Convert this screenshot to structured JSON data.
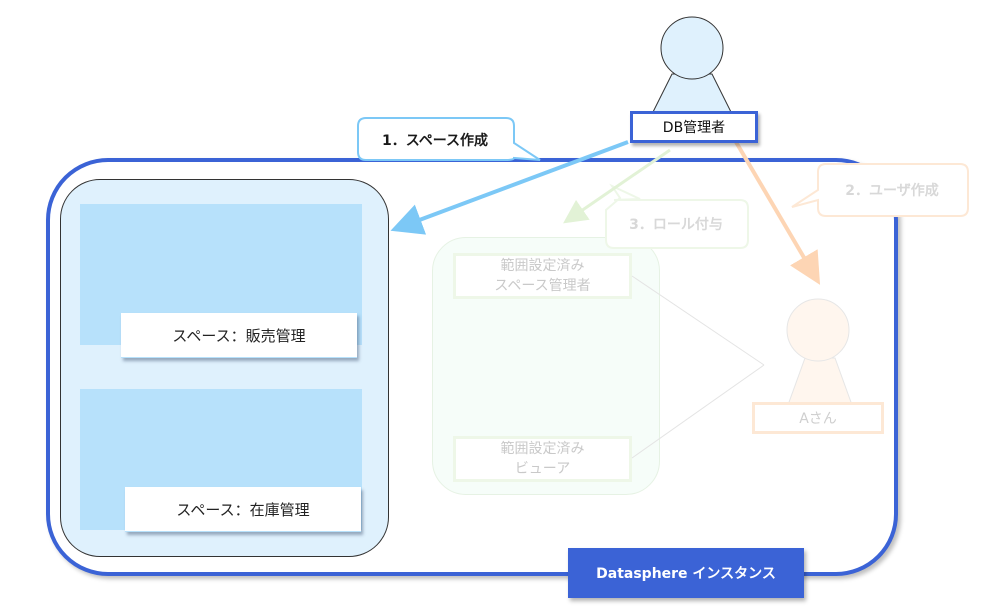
{
  "diagram": {
    "instance": {
      "label": "Datasphere インスタンス"
    },
    "spaces": [
      {
        "label": "スペース：販売管理"
      },
      {
        "label": "スペース：在庫管理"
      }
    ],
    "roles": [
      {
        "line1": "範囲設定済み",
        "line2": "スペース管理者"
      },
      {
        "line1": "範囲設定済み",
        "line2": "ビューア"
      }
    ],
    "actors": {
      "admin": {
        "label": "DB管理者"
      },
      "user": {
        "label": "Aさん"
      }
    },
    "steps": [
      {
        "label": "1．スペース作成",
        "state": "active"
      },
      {
        "label": "2．ユーザ作成",
        "state": "faded"
      },
      {
        "label": "3．ロール付与",
        "state": "faded"
      }
    ],
    "colors": {
      "instance_blue": "#3b63d6",
      "space_light_blue": "#b7e1fb",
      "space_container_bg": "#dff1fd",
      "step1_arrow": "#7cc8f6",
      "step2_arrow": "#fdd5b4",
      "step3_arrow": "#e2f2d6"
    }
  }
}
